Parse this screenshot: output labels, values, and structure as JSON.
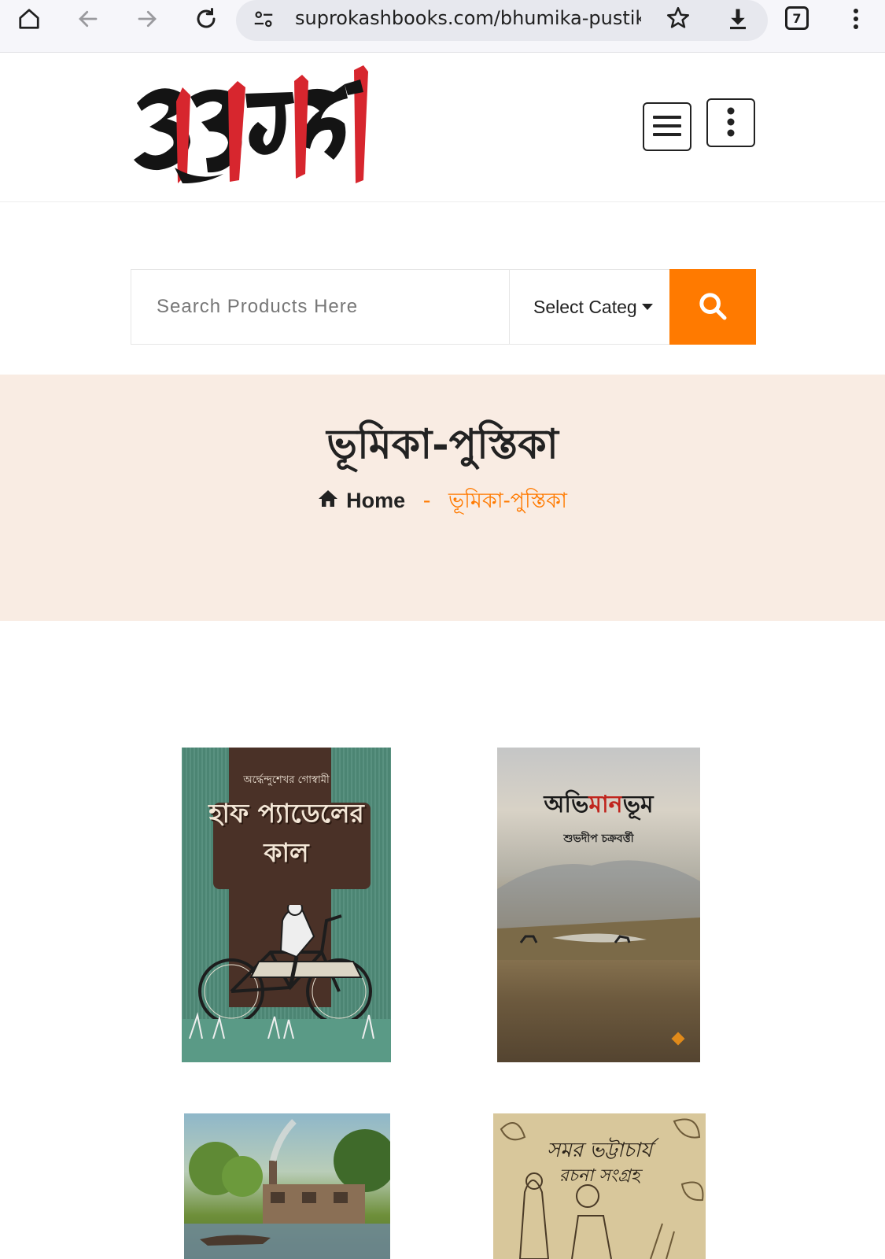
{
  "browser": {
    "url": "suprokashbooks.com/bhumika-pustika",
    "tab_count": "7",
    "icons": [
      "home-icon",
      "back-icon",
      "forward-icon",
      "reload-icon",
      "site-settings-icon",
      "bookmark-star-icon",
      "download-icon",
      "tabs-icon",
      "more-icon"
    ]
  },
  "header": {
    "logo_text": "সুপ্রকাশ",
    "icons": [
      "hamburger-menu-icon",
      "more-vertical-icon"
    ]
  },
  "search": {
    "placeholder": "Search Products Here",
    "category_label": "Select Categ",
    "button_icon": "search-icon"
  },
  "banner": {
    "title": "ভূমিকা-পুস্তিকা",
    "breadcrumb": {
      "home_label": "Home",
      "separator": "-",
      "current": "ভূমিকা-পুস্তিকা"
    }
  },
  "products": [
    {
      "author": "অর্দ্ধেন্দুশেখর গোস্বামী",
      "title_line1": "হাফ প্যাডেলের",
      "title_line2": "কাল"
    },
    {
      "title_part1": "অভি",
      "title_part2": "মান",
      "title_part3": "ভূম",
      "author": "শুভদীপ চক্রবর্ত্তী"
    },
    {
      "title": ""
    },
    {
      "title_line1": "সমর ভট্টাচার্য",
      "title_line2": "রচনা সংগ্রহ"
    }
  ],
  "colors": {
    "accent": "#ff7a00",
    "banner_bg": "#f9ece3",
    "logo_red": "#d7262e"
  }
}
